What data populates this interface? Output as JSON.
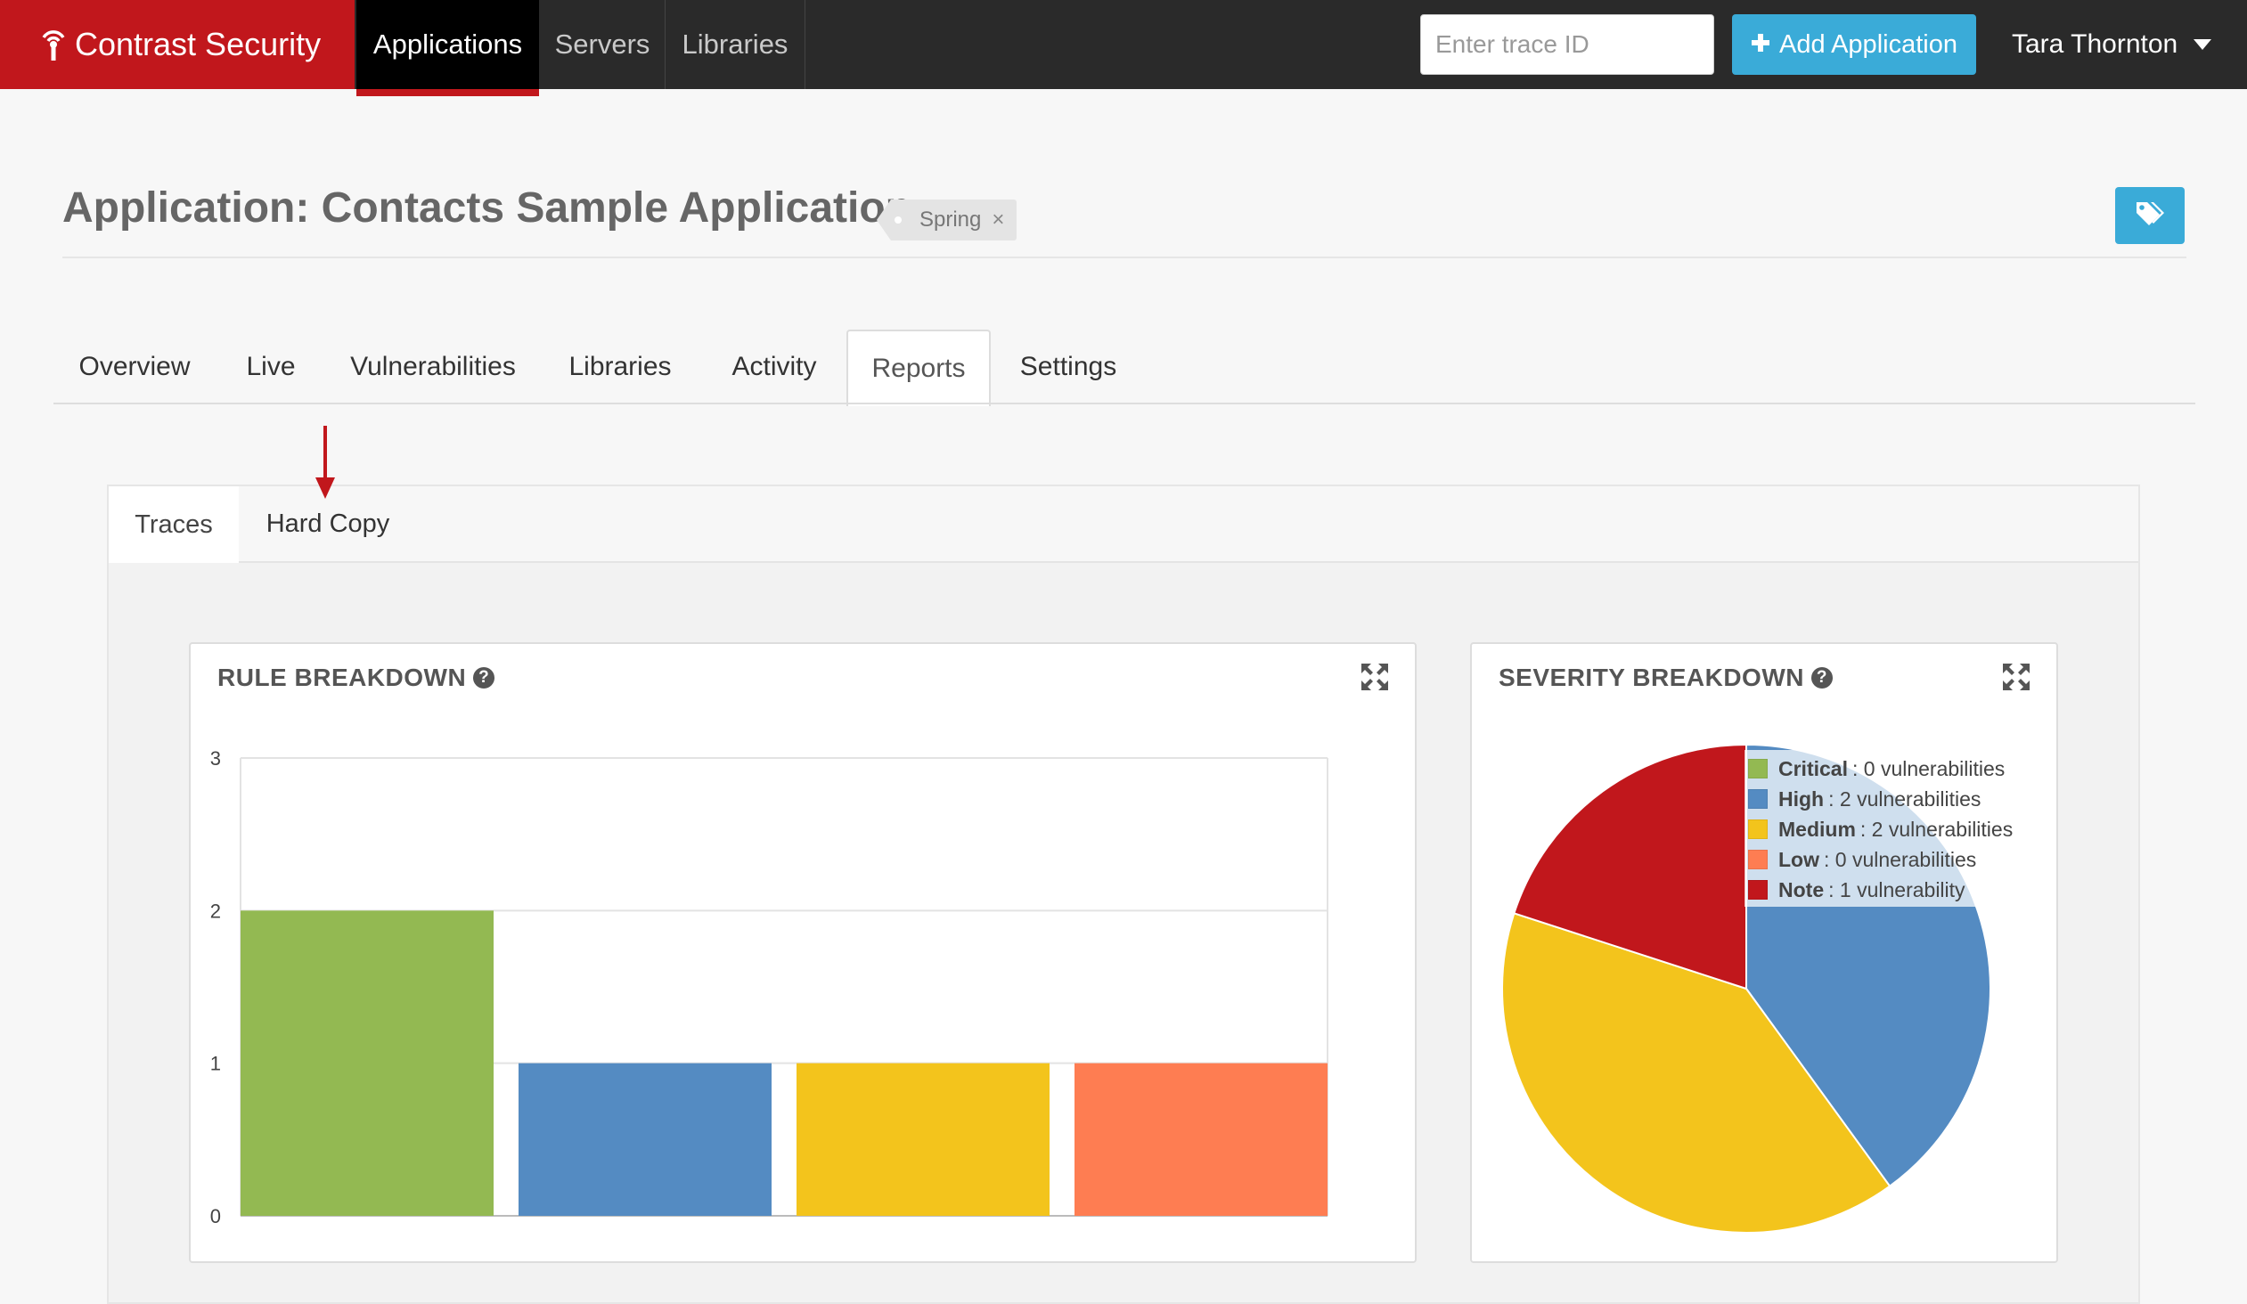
{
  "navbar": {
    "brand": "Contrast Security",
    "items": [
      {
        "label": "Applications",
        "active": true
      },
      {
        "label": "Servers",
        "active": false
      },
      {
        "label": "Libraries",
        "active": false
      }
    ],
    "trace_placeholder": "Enter trace ID",
    "add_application_label": "Add Application",
    "user_name": "Tara Thornton"
  },
  "header": {
    "title": "Application: Contacts Sample Application",
    "tag": "Spring"
  },
  "tabs": [
    {
      "label": "Overview",
      "active": false
    },
    {
      "label": "Live",
      "active": false
    },
    {
      "label": "Vulnerabilities",
      "active": false
    },
    {
      "label": "Libraries",
      "active": false
    },
    {
      "label": "Activity",
      "active": false
    },
    {
      "label": "Reports",
      "active": true
    },
    {
      "label": "Settings",
      "active": false
    }
  ],
  "subtabs": [
    {
      "label": "Traces",
      "active": true
    },
    {
      "label": "Hard Copy",
      "active": false
    }
  ],
  "colors": {
    "brand_red": "#c1171c",
    "accent_blue": "#3aabd8",
    "critical": "#93b952",
    "high": "#548bc2",
    "medium": "#f3c41c",
    "low": "#fe7d52",
    "note": "#c1171c"
  },
  "chart_data": [
    {
      "type": "bar",
      "title": "RULE BREAKDOWN",
      "categories": [
        "",
        "",
        "",
        ""
      ],
      "values": [
        2,
        1,
        1,
        1
      ],
      "bar_colors": [
        "#93b952",
        "#548bc2",
        "#f3c41c",
        "#fe7d52"
      ],
      "ylim": [
        0,
        3
      ],
      "yticks": [
        "0",
        "1",
        "2",
        "3"
      ],
      "grid": true
    },
    {
      "type": "pie",
      "title": "SEVERITY BREAKDOWN",
      "legend_position": "top-right",
      "slices": [
        {
          "label": "Critical",
          "text": "0 vulnerabilities",
          "value": 0,
          "color": "#93b952"
        },
        {
          "label": "High",
          "text": "2 vulnerabilities",
          "value": 2,
          "color": "#548bc2"
        },
        {
          "label": "Medium",
          "text": "2 vulnerabilities",
          "value": 2,
          "color": "#f3c41c"
        },
        {
          "label": "Low",
          "text": "0 vulnerabilities",
          "value": 0,
          "color": "#fe7d52"
        },
        {
          "label": "Note",
          "text": "1 vulnerability",
          "value": 1,
          "color": "#c1171c"
        }
      ]
    }
  ]
}
